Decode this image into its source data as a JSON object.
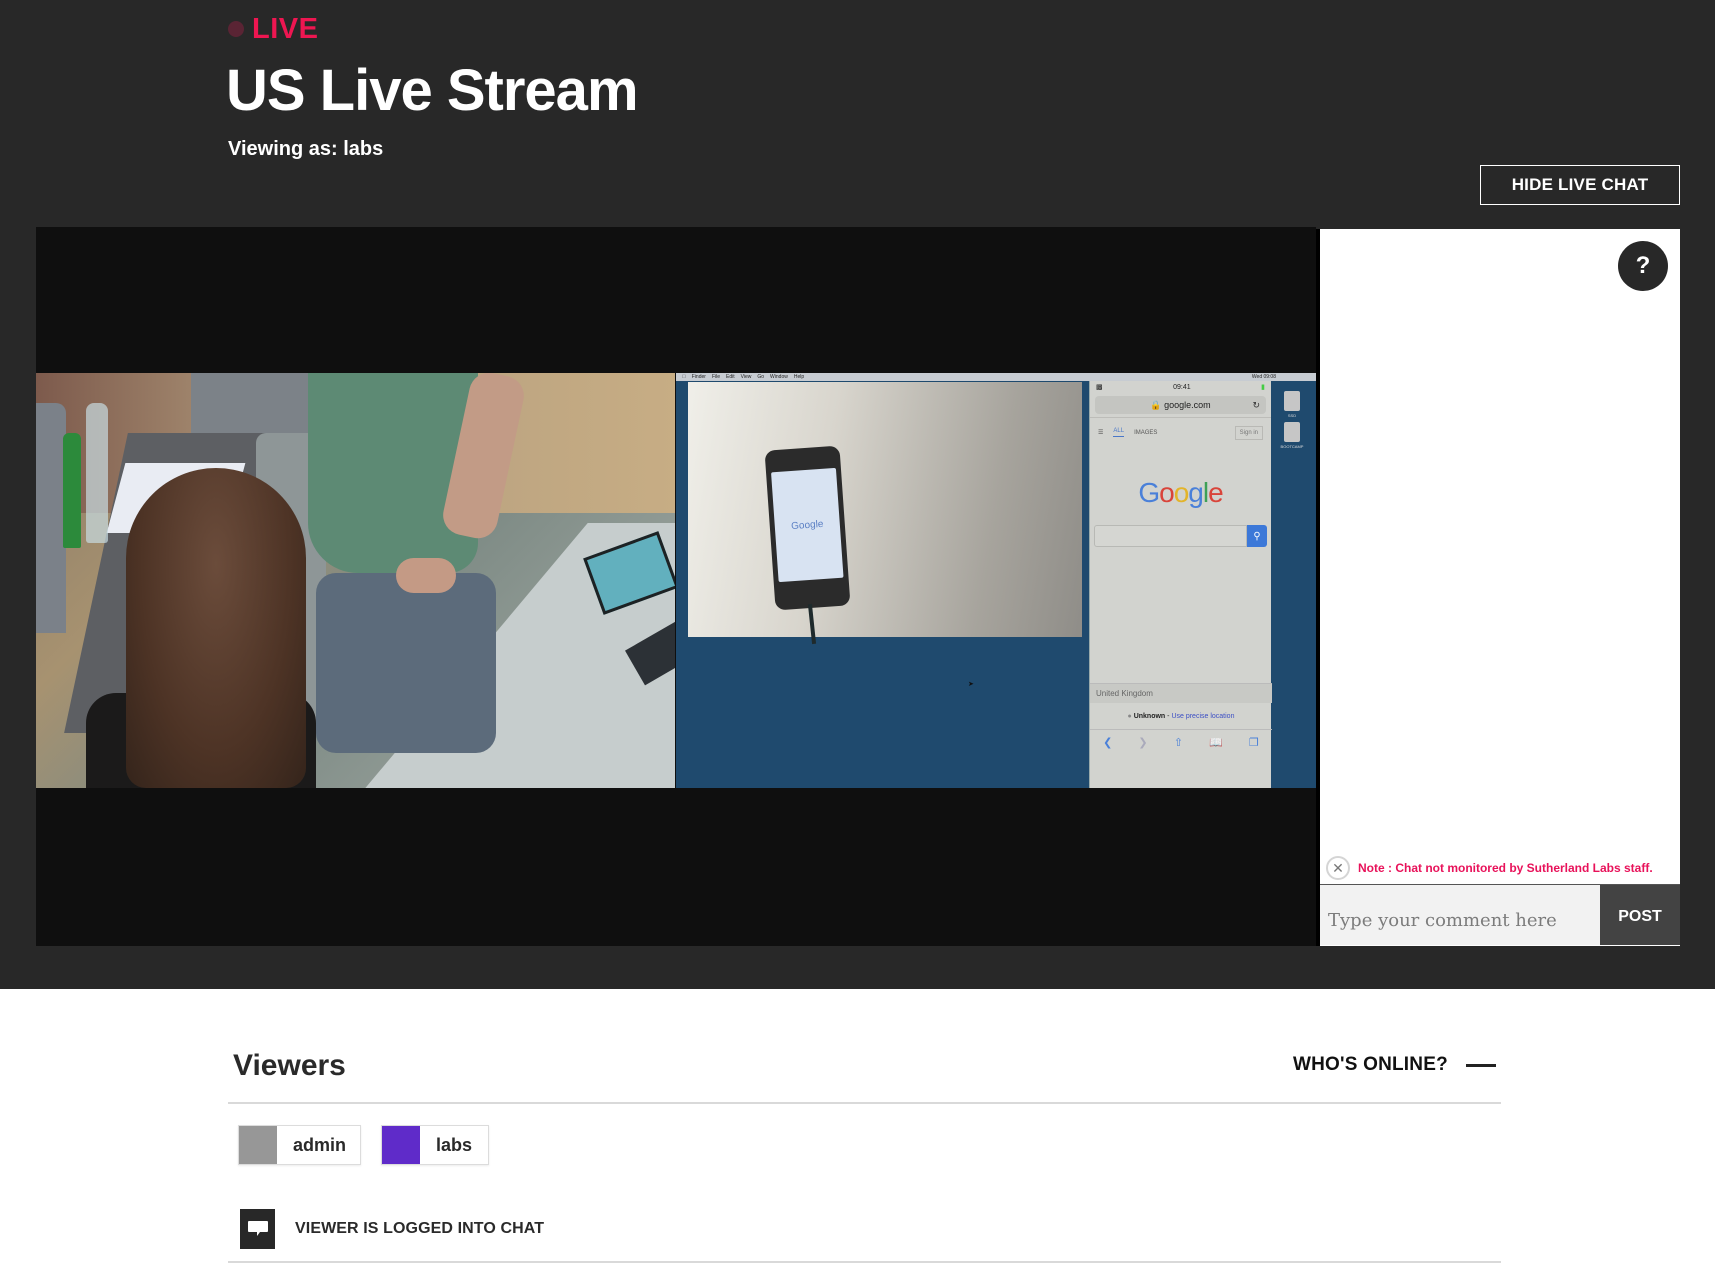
{
  "header": {
    "live_label": "LIVE",
    "title": "US Live Stream",
    "viewing_as": "Viewing as: labs",
    "hide_chat_label": "HIDE LIVE CHAT"
  },
  "colors": {
    "live_accent": "#ee1651",
    "note_accent": "#e8125a",
    "hero_bg": "#282828",
    "post_button_bg": "#434343"
  },
  "video": {
    "screen_share": {
      "menubar": [
        "Finder",
        "File",
        "Edit",
        "View",
        "Go",
        "Window",
        "Help"
      ],
      "menubar_clock": "Wed 09:08",
      "phone_time": "09:41",
      "url": "google.com",
      "tabs": [
        "ALL",
        "IMAGES"
      ],
      "sign_in": "Sign in",
      "country": "United Kingdom",
      "location_status": "Unknown",
      "location_separator": " - ",
      "location_link": "Use precise location",
      "desktop_icons": [
        "SSD",
        "BOOTCAMP"
      ]
    }
  },
  "chat": {
    "help_label": "?",
    "note": "Note : Chat not monitored by Sutherland Labs staff.",
    "input_placeholder": "Type your comment here",
    "input_value": "",
    "post_label": "POST"
  },
  "viewers": {
    "title": "Viewers",
    "whos_online_label": "WHO'S ONLINE?",
    "list": [
      {
        "name": "admin",
        "color": "#979797"
      },
      {
        "name": "labs",
        "color": "#5f2bc9"
      }
    ],
    "legend_label": "VIEWER IS LOGGED INTO CHAT"
  }
}
